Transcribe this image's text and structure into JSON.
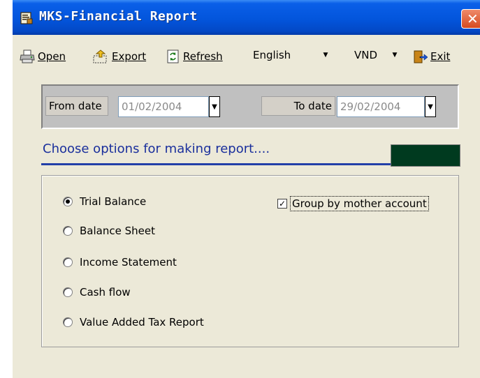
{
  "window": {
    "title": "MKS-Financial Report"
  },
  "toolbar": {
    "open_label": "Open",
    "export_label": "Export",
    "refresh_label": "Refresh",
    "language_value": "English",
    "currency_value": "VND",
    "exit_label": "Exit"
  },
  "dates": {
    "from_label": "From date",
    "from_value": "01/02/2004",
    "to_label": "To date",
    "to_value": "29/02/2004"
  },
  "options": {
    "heading": "Choose options for making report....",
    "reports": [
      "Trial Balance",
      "Balance Sheet",
      "Income Statement",
      "Cash flow",
      "Value Added Tax Report"
    ],
    "selected": "Trial Balance",
    "group_label": "Group by mother account",
    "group_checked": true
  },
  "colors": {
    "title_bar": "#0355dc",
    "heading_text": "#1a2f9c",
    "status_box": "#003a1f"
  },
  "icons": [
    "report-icon",
    "close-icon",
    "printer-icon",
    "export-icon",
    "refresh-icon",
    "exit-door-icon"
  ]
}
